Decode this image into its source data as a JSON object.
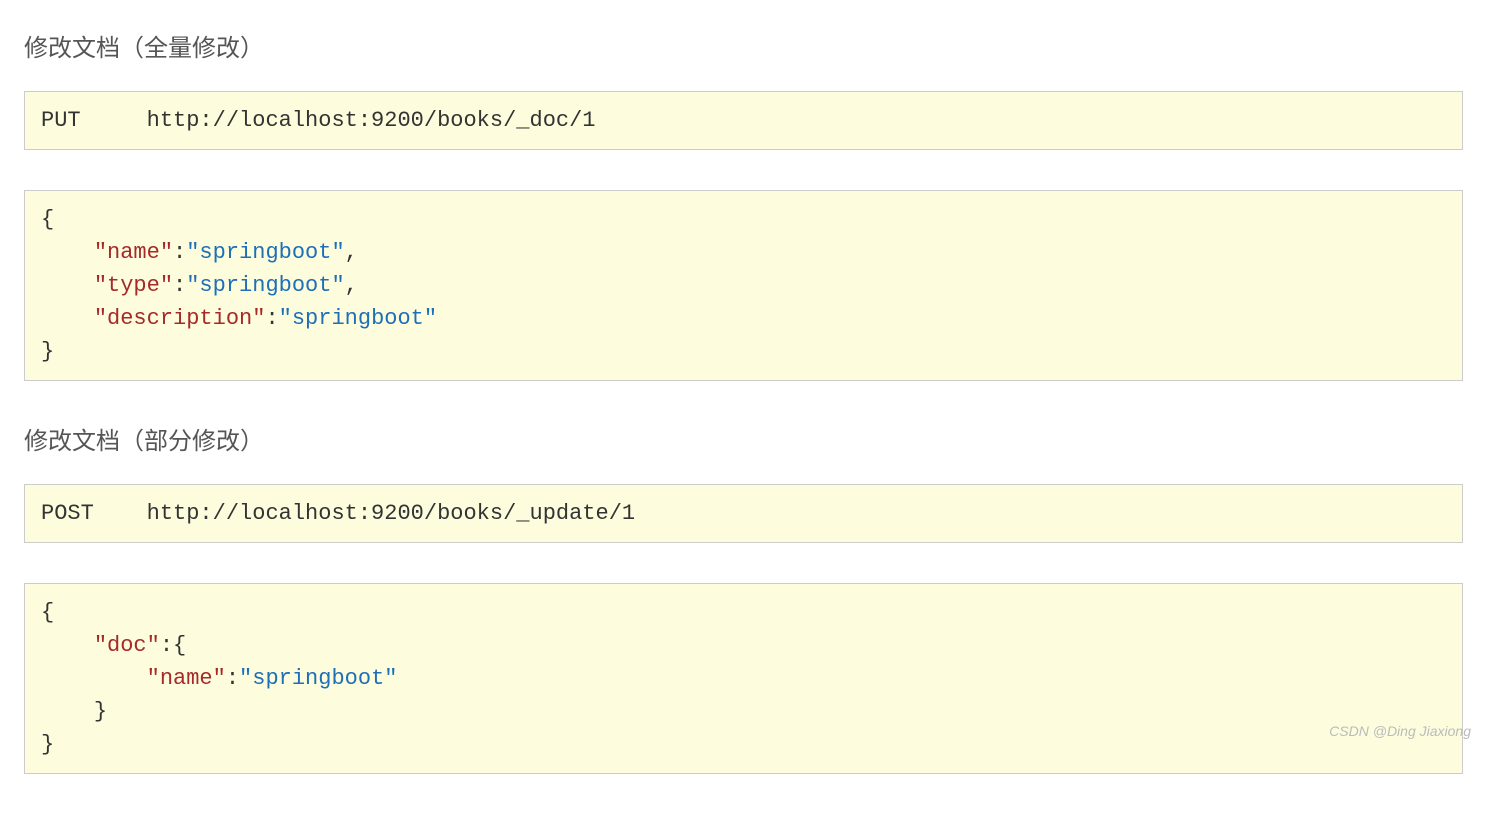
{
  "section1": {
    "title": "修改文档（全量修改）",
    "request": {
      "method": "PUT",
      "spacer": "\t",
      "url": "http://localhost:9200/books/_doc/1"
    },
    "body": {
      "pairs": [
        {
          "key": "\"name\"",
          "colon": ":",
          "value": "\"springboot\"",
          "comma": ","
        },
        {
          "key": "\"type\"",
          "colon": ":",
          "value": "\"springboot\"",
          "comma": ","
        },
        {
          "key": "\"description\"",
          "colon": ":",
          "value": "\"springboot\"",
          "comma": ""
        }
      ]
    }
  },
  "section2": {
    "title": "修改文档（部分修改）",
    "request": {
      "method": "POST",
      "spacer": "\t",
      "url": "http://localhost:9200/books/_update/1"
    },
    "body": {
      "docKey": "\"doc\"",
      "docColon": ":",
      "innerPairs": [
        {
          "key": "\"name\"",
          "colon": ":",
          "value": "\"springboot\"",
          "comma": ""
        }
      ]
    }
  },
  "watermark": "CSDN @Ding Jiaxiong"
}
